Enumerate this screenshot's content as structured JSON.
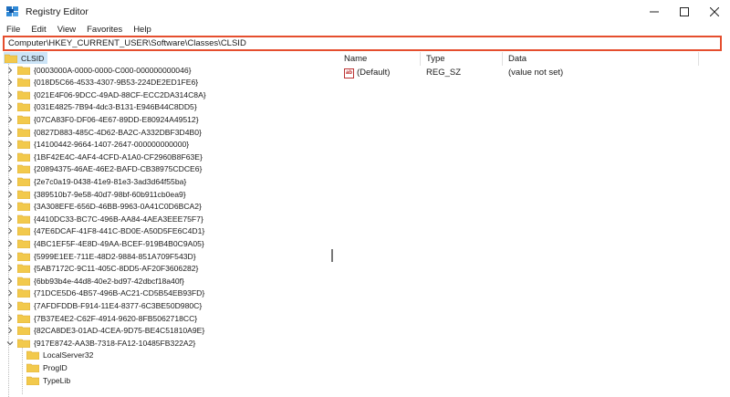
{
  "window": {
    "title": "Registry Editor",
    "icon": "registry-editor-icon",
    "minimize_icon": "minimize-icon",
    "maximize_icon": "maximize-icon",
    "close_icon": "close-icon"
  },
  "menu": [
    "File",
    "Edit",
    "View",
    "Favorites",
    "Help"
  ],
  "address": {
    "value": "Computer\\HKEY_CURRENT_USER\\Software\\Classes\\CLSID",
    "highlight_color": "#e54e2e"
  },
  "tree": {
    "root_label": "CLSID",
    "items": [
      "{0003000A-0000-0000-C000-000000000046}",
      "{018D5C66-4533-4307-9B53-224DE2ED1FE6}",
      "{021E4F06-9DCC-49AD-88CF-ECC2DA314C8A}",
      "{031E4825-7B94-4dc3-B131-E946B44C8DD5}",
      "{07CA83F0-DF06-4E67-89DD-E80924A49512}",
      "{0827D883-485C-4D62-BA2C-A332DBF3D4B0}",
      "{14100442-9664-1407-2647-000000000000}",
      "{1BF42E4C-4AF4-4CFD-A1A0-CF2960B8F63E}",
      "{20894375-46AE-46E2-BAFD-CB38975CDCE6}",
      "{2e7c0a19-0438-41e9-81e3-3ad3d64f55ba}",
      "{389510b7-9e58-40d7-98bf-60b911cb0ea9}",
      "{3A308EFE-656D-46BB-9963-0A41C0D6BCA2}",
      "{4410DC33-BC7C-496B-AA84-4AEA3EEE75F7}",
      "{47E6DCAF-41F8-441C-BD0E-A50D5FE6C4D1}",
      "{4BC1EF5F-4E8D-49AA-BCEF-919B4B0C9A05}",
      "{5999E1EE-711E-48D2-9884-851A709F543D}",
      "{5AB7172C-9C11-405C-8DD5-AF20F3606282}",
      "{6bb93b4e-44d8-40e2-bd97-42dbcf18a40f}",
      "{71DCE5D6-4B57-496B-AC21-CD5B54EB93FD}",
      "{7AFDFDDB-F914-11E4-8377-6C3BE50D980C}",
      "{7B37E4E2-C62F-4914-9620-8FB5062718CC}",
      "{82CA8DE3-01AD-4CEA-9D75-BE4C51810A9E}",
      "{917E8742-AA3B-7318-FA12-10485FB322A2}"
    ],
    "children": [
      "LocalServer32",
      "ProgID",
      "TypeLib"
    ]
  },
  "list": {
    "columns": [
      "Name",
      "Type",
      "Data"
    ],
    "rows": [
      {
        "name": "(Default)",
        "type": "REG_SZ",
        "data": "(value not set)",
        "icon": "string-value-icon"
      }
    ]
  }
}
